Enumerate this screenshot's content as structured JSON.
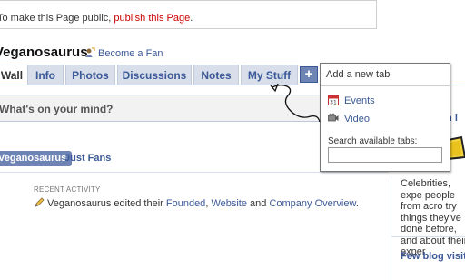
{
  "notice": {
    "prefix": "To make this Page public, ",
    "link": "publish this Page",
    "suffix": "."
  },
  "page": {
    "title": "Veganosaurus",
    "become_fan": "Become a Fan"
  },
  "tabs": [
    "Wall",
    "Info",
    "Photos",
    "Discussions",
    "Notes",
    "My Stuff"
  ],
  "plus_label": "+",
  "status": {
    "placeholder": "What's on your mind?"
  },
  "filters": {
    "active": "Veganosaurus",
    "other": "Just Fans"
  },
  "recent": {
    "label": "RECENT ACTIVITY",
    "prefix": "Veganosaurus edited their ",
    "link1": "Founded",
    "sep1": ", ",
    "link2": "Website",
    "sep2": " and ",
    "link3": "Company Overview",
    "suffix": "."
  },
  "dropdown": {
    "title": "Add a new tab",
    "items": [
      {
        "label": "Events",
        "icon": "calendar-icon"
      },
      {
        "label": "Video",
        "icon": "video-camera-icon"
      }
    ],
    "search_label": "Search available tabs:"
  },
  "right": {
    "login_partial": "in l",
    "text": "Celebrities, expe people from acro try things they've done before, and about their exper",
    "heading": "Few blog visito"
  },
  "colors": {
    "link": "#3b5998",
    "accent": "#6d84b4",
    "notice_link": "#cc0000"
  }
}
